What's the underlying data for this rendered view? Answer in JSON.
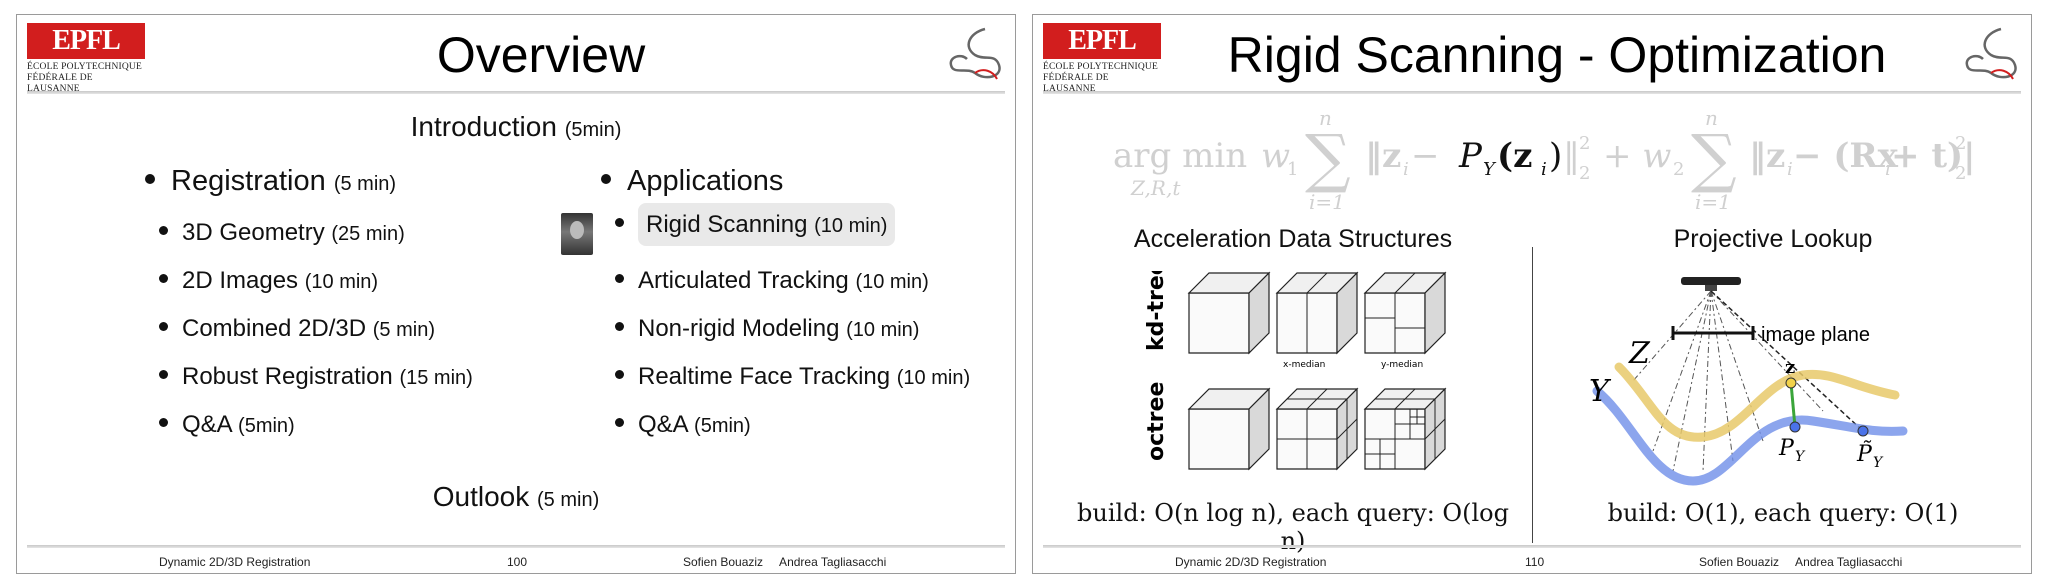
{
  "slide1": {
    "logo_text": "EPFL",
    "logo_line1": "ÉCOLE POLYTECHNIQUE",
    "logo_line2": "FÉDÉRALE DE LAUSANNE",
    "title": "Overview",
    "intro": {
      "label": "Introduction",
      "dur": "(5min)"
    },
    "left_items": [
      {
        "label": "Registration",
        "dur": "(5 min)"
      },
      {
        "label": "3D Geometry",
        "dur": "(25 min)"
      },
      {
        "label": "2D Images",
        "dur": "(10 min)"
      },
      {
        "label": "Combined 2D/3D",
        "dur": "(5 min)"
      },
      {
        "label": "Robust Registration",
        "dur": "(15 min)"
      },
      {
        "label": "Q&A",
        "dur": "(5min)"
      }
    ],
    "right_items": [
      {
        "label": "Applications",
        "dur": ""
      },
      {
        "label": "Rigid Scanning",
        "dur": "(10 min)"
      },
      {
        "label": "Articulated Tracking",
        "dur": "(10 min)"
      },
      {
        "label": "Non-rigid Modeling",
        "dur": "(10 min)"
      },
      {
        "label": "Realtime Face Tracking",
        "dur": "(10 min)"
      },
      {
        "label": "Q&A",
        "dur": "(5min)"
      }
    ],
    "outlook": {
      "label": "Outlook",
      "dur": "(5 min)"
    },
    "footer": {
      "left": "Dynamic 2D/3D Registration",
      "page": "100",
      "authors": "Sofien Bouaziz     Andrea Tagliasacchi"
    }
  },
  "slide2": {
    "logo_text": "EPFL",
    "logo_line1": "ÉCOLE POLYTECHNIQUE",
    "logo_line2": "FÉDÉRALE DE LAUSANNE",
    "title": "Rigid Scanning - Optimization",
    "formula": {
      "argmin": "arg min",
      "sub": "Z,R,t",
      "w1": "w",
      "sum_top": "n",
      "sum_bot": "i=1",
      "term1_a": "‖z",
      "term1_b": " − ",
      "term1_hl": "P",
      "term1_hl_sub": "Y",
      "term1_hl_arg": "(z",
      "term1_close": ")‖",
      "plus": "+ w",
      "term2": "‖z",
      "term2_b": " − (Rx",
      "term2_c": " + t)‖",
      "sub_i": "i",
      "sq": "2",
      "one": "1",
      "two": "2"
    },
    "left_heading": "Acceleration Data Structures",
    "row_labels": [
      "kd-tree",
      "octree"
    ],
    "cube_captions": [
      "x-median",
      "y-median"
    ],
    "left_build": "build: O(n log n), each query: O(log n)",
    "right_heading": "Projective Lookup",
    "image_plane": "image plane",
    "label_Z": "Z",
    "label_Y": "Y",
    "label_z": "z",
    "label_P": "P",
    "label_Psub": "Y",
    "label_Phat": "P̃",
    "right_build": "build: O(1), each query: O(1)",
    "footer": {
      "left": "Dynamic 2D/3D Registration",
      "page": "110",
      "authors": "Sofien Bouaziz     Andrea Tagliasacchi"
    }
  },
  "colors": {
    "epfl_red": "#d21e1e",
    "highlight": "#e9e9e9",
    "curve_yellow": "#e8c96a",
    "curve_blue": "#6f8fe8",
    "formula_faded": "#d0d0d0"
  }
}
